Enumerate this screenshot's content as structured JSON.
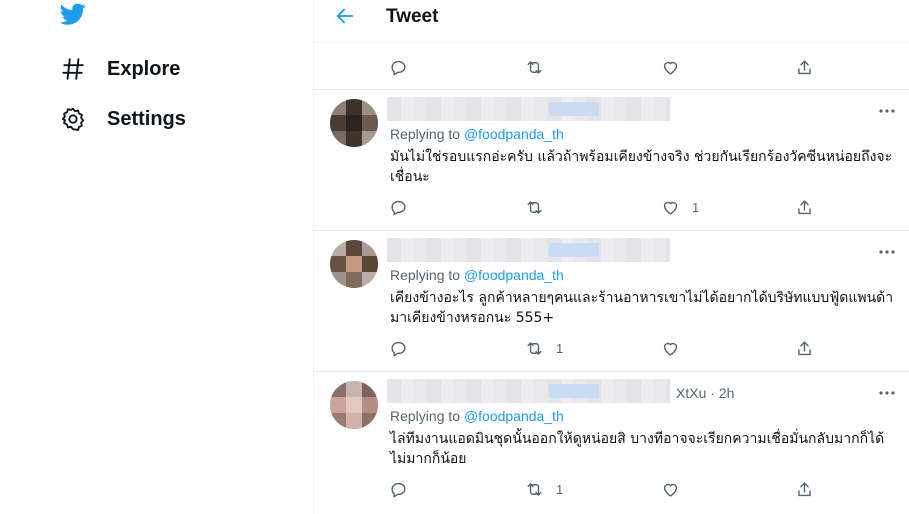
{
  "sidebar": {
    "items": [
      {
        "label": "Explore",
        "icon": "hashtag-icon"
      },
      {
        "label": "Settings",
        "icon": "gear-icon"
      }
    ]
  },
  "header": {
    "title": "Tweet"
  },
  "top_actions": {
    "reply_count": "",
    "retweet_count": "",
    "like_count": "",
    "share": ""
  },
  "replies": [
    {
      "handle_tail": "",
      "replying_prefix": "Replying to",
      "mention": "@foodpanda_th",
      "text": "มันไม่ใช่รอบแรกอ่ะครับ แล้วถ้าพร้อมเคียงข้างจริง ช่วยกันเรียกร้องวัคซีนหน่อยถึงจะเชื่อนะ",
      "reply_count": "",
      "retweet_count": "",
      "like_count": "1"
    },
    {
      "handle_tail": "",
      "replying_prefix": "Replying to",
      "mention": "@foodpanda_th",
      "text": "เคียงข้างอะไร ลูกค้าหลายๆคนและร้านอาหารเขาไม่ได้อยากได้บริษัทแบบฟู้ดแพนด้ามาเคียงข้างหรอกนะ 555+",
      "reply_count": "",
      "retweet_count": "1",
      "like_count": ""
    },
    {
      "handle_tail": "XtXu · 2h",
      "replying_prefix": "Replying to",
      "mention": "@foodpanda_th",
      "text": "ไล่ทีมงานแอดมินชุดนั้นออกให้ดูหน่อยสิ บางทีอาจจะเรียกความเชื่อมั่นกลับมากก็ได้ ไม่มากก็น้อย",
      "reply_count": "",
      "retweet_count": "1",
      "like_count": ""
    }
  ],
  "colors": {
    "accent": "#1d9bf0",
    "muted": "#536471",
    "border": "#eff3f4"
  }
}
